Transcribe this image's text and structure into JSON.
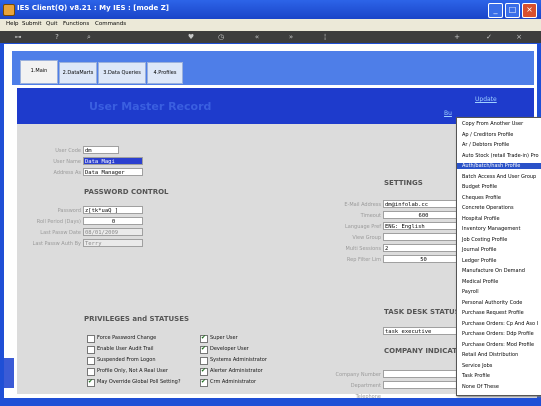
{
  "window": {
    "title": "IES Client(Q) v8.21 : My IES :       [mode Z]",
    "controls": [
      "minimize-icon",
      "maximize-icon",
      "close-icon"
    ]
  },
  "menubar": {
    "items": [
      "Help",
      "Submit",
      "Quit",
      "Functions",
      "Commands"
    ]
  },
  "toolbar": {
    "icons": [
      "key-icon",
      "help-icon",
      "search-icon",
      "heart-icon",
      "clock-icon",
      "rewind-icon",
      "fast-forward-icon",
      "pin-icon",
      "plus-icon",
      "check-icon",
      "close-icon"
    ]
  },
  "tabs": [
    {
      "label": "1.Main"
    },
    {
      "label": "2.DataMarts"
    },
    {
      "label": "3.Data Queries"
    },
    {
      "label": "4.Profiles"
    }
  ],
  "header": {
    "title": "User Master Record",
    "update_link": "Update",
    "bu_link": "Bu"
  },
  "user": {
    "user_code_label": "User Code",
    "user_code": "dm",
    "user_name_label": "User Name",
    "user_name": "Data Magi",
    "address_as_label": "Address As",
    "address_as": "Data Manager"
  },
  "password": {
    "section": "PASSWORD CONTROL",
    "password_label": "Password",
    "password": "z[tk*uaQ ]",
    "roll_period_label": "Roll Period (Days)",
    "roll_period": "0",
    "last_date_label": "Last Passw Date",
    "last_date": "08/01/2009",
    "last_by_label": "Last Passw Auth By",
    "last_by": "Terry"
  },
  "settings": {
    "section": "SETTINGS",
    "email_label": "E-Mail Address",
    "email": "dm@infolab.cc",
    "timeout_label": "Timeout",
    "timeout": "600",
    "language_label": "Language Pref",
    "language": "ENG: English",
    "view_group_label": "View Group",
    "view_group": "",
    "multi_sessions_label": "Multi Sessions",
    "multi_sessions": "2",
    "rec_filter_label": "Rep Filter Lim",
    "rec_filter": "50"
  },
  "privileges": {
    "section": "PRIVILEGES and STATUSES",
    "left": [
      {
        "label": "Force Password Change",
        "checked": false
      },
      {
        "label": "Enable User Audit Trail",
        "checked": false
      },
      {
        "label": "Suspended From Logon",
        "checked": false
      },
      {
        "label": "Profile Only, Not A Real User",
        "checked": false
      },
      {
        "label": "May Override Global Poll Setting?",
        "checked": true
      }
    ],
    "right": [
      {
        "label": "Super User",
        "checked": true
      },
      {
        "label": "Developer User",
        "checked": true
      },
      {
        "label": "Systems Administrator",
        "checked": false
      },
      {
        "label": "Alerter Administrator",
        "checked": true
      },
      {
        "label": "Crm Administrator",
        "checked": true
      }
    ]
  },
  "task_desk": {
    "section": "TASK DESK STATUS",
    "value": "task executive"
  },
  "company": {
    "section": "COMPANY INDICATO",
    "company_number_label": "Company Number",
    "department_label": "Department",
    "telephone_label": "Telephone"
  },
  "dropdown": {
    "items": [
      "Copy From Another User",
      "Ap / Creditors Profile",
      "Ar / Debtors Profile",
      "Auto Stock (retail Trade-in) Pro",
      "Auth/batch/hash Profile",
      "Batch Access And User Group",
      "Budget Profile",
      "Cheques Profile",
      "Concrete Operations",
      "Hospital Profile",
      "Inventory Management",
      "Job Costing Profile",
      "Journal Profile",
      "Ledger Profile",
      "Manufacture On Demand",
      "Medical Profile",
      "Payroll",
      "Personal Authority Code",
      "Purchase Request Profile",
      "Purchase Orders: Cp And Aso I",
      "Purchase Orders: Ddp Profile",
      "Purchase Orders: Mod Profile",
      "Retail And Distribution",
      "Service Jobs",
      "Task Profile",
      "None Of These"
    ],
    "selected_index": 4
  }
}
